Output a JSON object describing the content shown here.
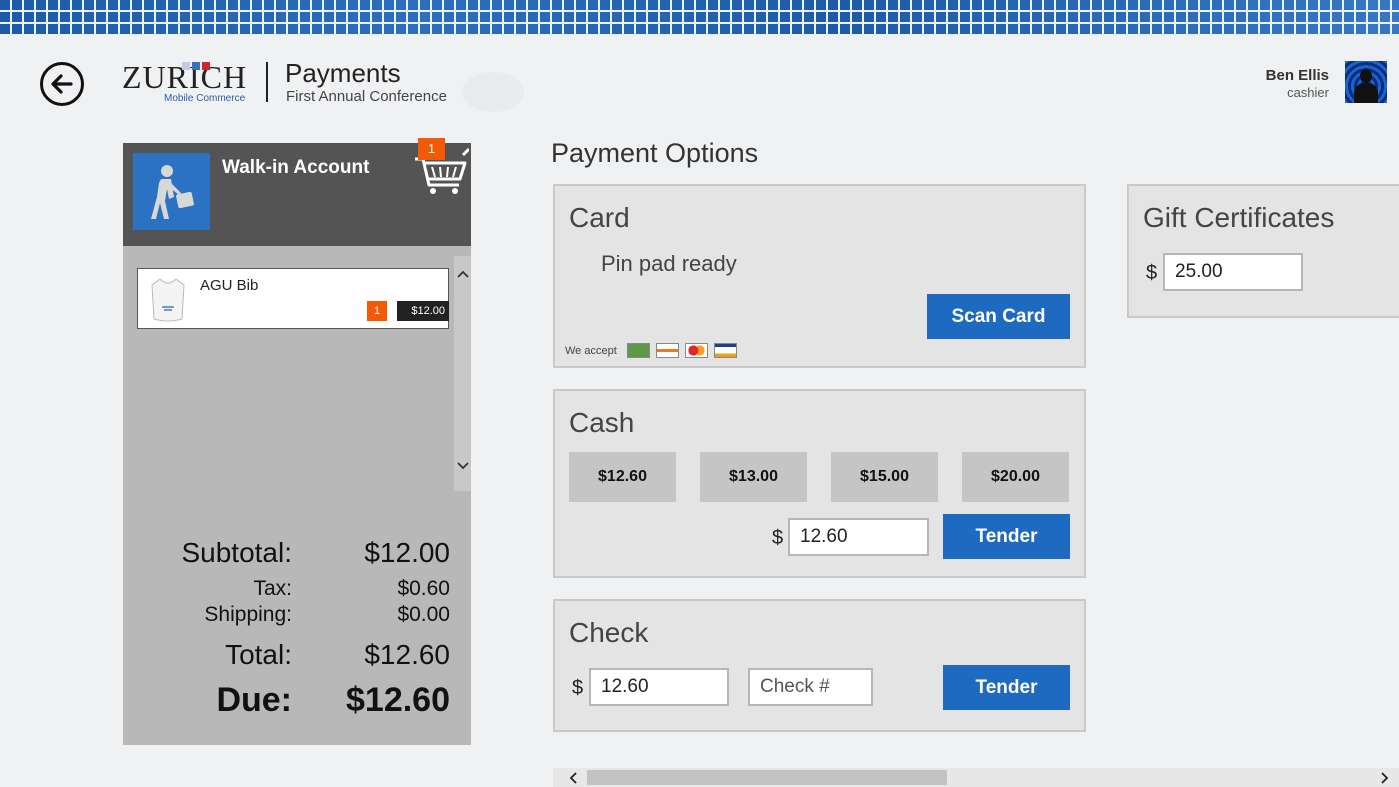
{
  "app": {
    "logo_text": "ZURICH",
    "logo_subtitle": "Mobile Commerce",
    "page_title": "Payments",
    "page_subtitle": "First Annual Conference"
  },
  "user": {
    "name": "Ben Ellis",
    "role": "cashier"
  },
  "cart": {
    "account_name": "Walk-in Account",
    "item_count": "1",
    "items": [
      {
        "name": "AGU Bib",
        "qty": "1",
        "price": "$12.00"
      }
    ],
    "totals": {
      "subtotal_label": "Subtotal:",
      "subtotal": "$12.00",
      "tax_label": "Tax:",
      "tax": "$0.60",
      "shipping_label": "Shipping:",
      "shipping": "$0.00",
      "total_label": "Total:",
      "total": "$12.60",
      "due_label": "Due:",
      "due": "$12.60"
    }
  },
  "payment": {
    "section_title": "Payment Options",
    "card": {
      "title": "Card",
      "status": "Pin pad ready",
      "scan_label": "Scan Card",
      "accept_label": "We accept",
      "accepted_icons": [
        "cash-icon",
        "discover-icon",
        "mastercard-icon",
        "visa-icon"
      ]
    },
    "cash": {
      "title": "Cash",
      "quick_amounts": [
        "$12.60",
        "$13.00",
        "$15.00",
        "$20.00"
      ],
      "currency_symbol": "$",
      "amount": "12.60",
      "tender_label": "Tender"
    },
    "check": {
      "title": "Check",
      "currency_symbol": "$",
      "amount": "12.60",
      "check_number_placeholder": "Check #",
      "tender_label": "Tender"
    },
    "gift": {
      "title": "Gift Certificates",
      "currency_symbol": "$",
      "amount": "25.00"
    }
  },
  "colors": {
    "accent_blue": "#1e6ac0",
    "badge_orange": "#f25a05",
    "cart_header": "#545454",
    "cart_body": "#b8b8b8"
  }
}
